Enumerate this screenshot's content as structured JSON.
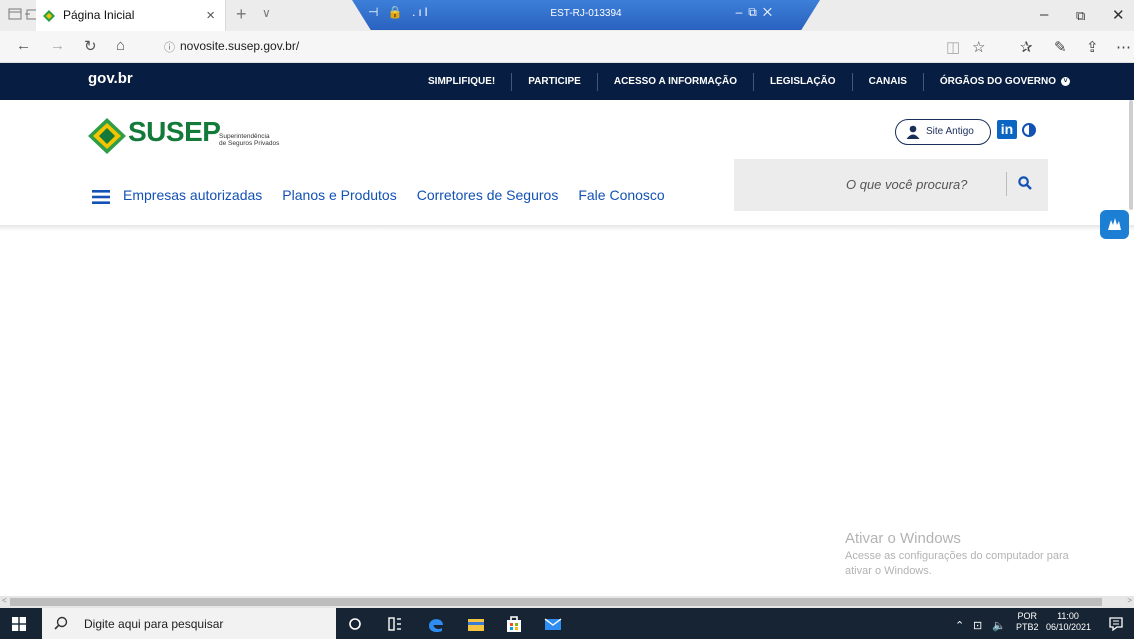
{
  "browser": {
    "tab_title": "Página Inicial",
    "url": "novosite.susep.gov.br/",
    "tab_close": "×",
    "new_tab": "+",
    "tab_menu": "∨"
  },
  "remote_session": {
    "title": "EST-RJ-013394"
  },
  "gov_bar": {
    "logo": "gov.br",
    "links": [
      "SIMPLIFIQUE!",
      "PARTICIPE",
      "ACESSO A INFORMAÇÃO",
      "LEGISLAÇÃO",
      "CANAIS",
      "ÓRGÃOS DO GOVERNO"
    ]
  },
  "site": {
    "logo_name": "SUSEP",
    "logo_subtitle_1": "Superintendência",
    "logo_subtitle_2": "de Seguros Privados",
    "site_antigo": "Site Antigo",
    "linkedin": "in",
    "nav": [
      "Empresas autorizadas",
      "Planos e Produtos",
      "Corretores de Seguros",
      "Fale Conosco"
    ],
    "search_placeholder": "O que você procura?"
  },
  "watermark": {
    "title": "Ativar o Windows",
    "line1": "Acesse as configurações do computador para",
    "line2": "ativar o Windows."
  },
  "taskbar": {
    "search_placeholder": "Digite aqui para pesquisar",
    "lang_1": "POR",
    "lang_2": "PTB2",
    "time": "11:00",
    "date": "06/10/2021"
  },
  "colors": {
    "gov_bar": "#071d41",
    "susep_green": "#147a3a",
    "susep_yellow": "#f5c400",
    "link_blue": "#1351b4",
    "taskbar": "#162433"
  }
}
